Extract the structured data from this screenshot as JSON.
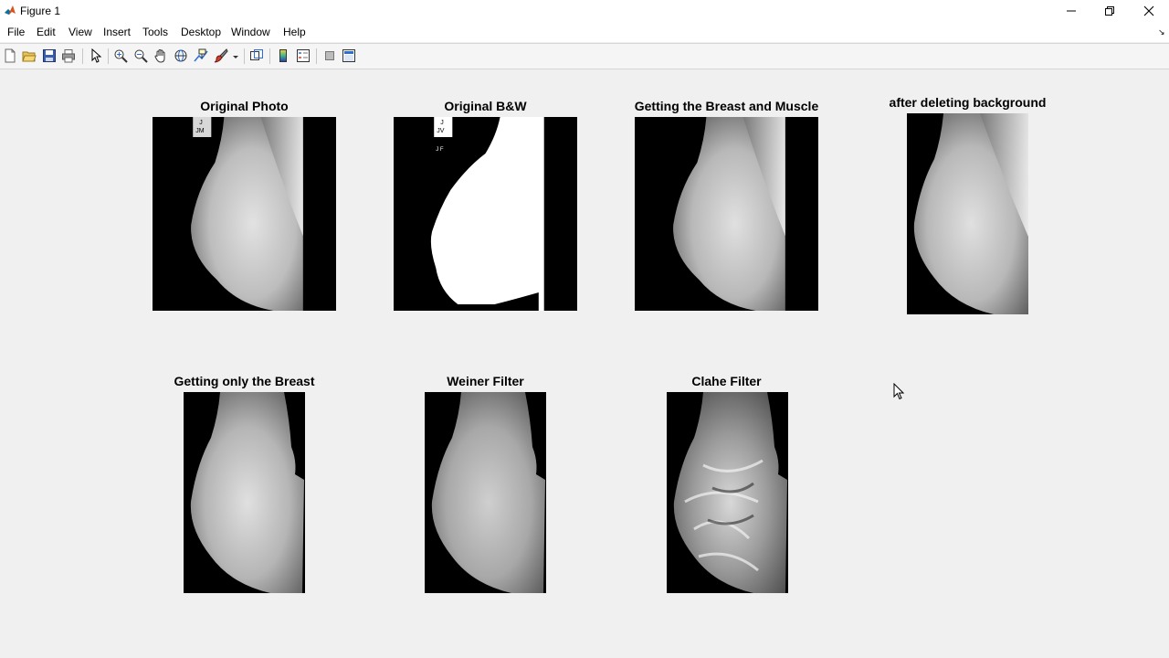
{
  "window": {
    "title": "Figure 1",
    "minimize_glyph": "minimize-icon",
    "maximize_glyph": "restore-icon",
    "close_glyph": "close-icon"
  },
  "menu": {
    "items": [
      "File",
      "Edit",
      "View",
      "Insert",
      "Tools",
      "Desktop",
      "Window",
      "Help"
    ]
  },
  "toolbar": {
    "icons": [
      "new-figure-icon",
      "open-file-icon",
      "save-icon",
      "print-icon",
      "edit-plot-icon",
      "zoom-in-icon",
      "zoom-out-icon",
      "pan-icon",
      "rotate-3d-icon",
      "data-cursor-icon",
      "brush-icon",
      "link-plot-icon",
      "insert-colorbar-icon",
      "insert-legend-icon",
      "hide-plot-tools-icon",
      "show-plot-tools-icon"
    ]
  },
  "figure": {
    "panels": [
      {
        "title": "Original Photo"
      },
      {
        "title": "Original B&W",
        "marker_top": "J",
        "marker_bottom": "JV",
        "marker_small": "J F"
      },
      {
        "title": "Getting the Breast and Muscle"
      },
      {
        "title": "after deleting background"
      },
      {
        "title": "Getting only the Breast"
      },
      {
        "title": "Weiner Filter"
      },
      {
        "title": "Clahe Filter"
      }
    ],
    "photo_marker": {
      "top": "J",
      "bottom": "JM"
    }
  },
  "colors": {
    "background": "#f0f0f0",
    "image_bg": "#000000",
    "tissue_light": "#e8e8e8",
    "tissue_dark": "#6a6a6a"
  }
}
